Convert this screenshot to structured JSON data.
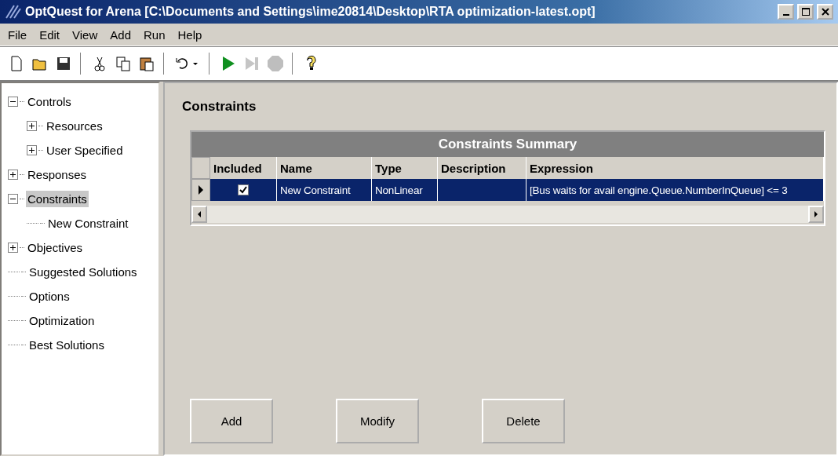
{
  "window": {
    "title": "OptQuest for Arena  [C:\\Documents and Settings\\ime20814\\Desktop\\RTA optimization-latest.opt]"
  },
  "menu": [
    "File",
    "Edit",
    "View",
    "Add",
    "Run",
    "Help"
  ],
  "toolbar": [
    {
      "kind": "new",
      "disabled": false
    },
    {
      "kind": "open",
      "disabled": false
    },
    {
      "kind": "save",
      "disabled": false
    },
    {
      "kind": "separator"
    },
    {
      "kind": "cut",
      "disabled": false
    },
    {
      "kind": "copy",
      "disabled": false
    },
    {
      "kind": "paste",
      "disabled": false
    },
    {
      "kind": "separator"
    },
    {
      "kind": "undo",
      "disabled": false
    },
    {
      "kind": "separator"
    },
    {
      "kind": "run",
      "disabled": false
    },
    {
      "kind": "step",
      "disabled": true
    },
    {
      "kind": "stop",
      "disabled": true
    },
    {
      "kind": "separator"
    },
    {
      "kind": "help",
      "disabled": false
    }
  ],
  "tree": [
    {
      "label": "Controls",
      "expanded": true,
      "selected": false,
      "children": [
        {
          "label": "Resources",
          "expanded": false,
          "selected": false
        },
        {
          "label": "User Specified",
          "expanded": false,
          "selected": false
        }
      ]
    },
    {
      "label": "Responses",
      "expanded": false,
      "selected": false
    },
    {
      "label": "Constraints",
      "expanded": true,
      "selected": true,
      "children": [
        {
          "label": "New Constraint",
          "selected": false
        }
      ]
    },
    {
      "label": "Objectives",
      "expanded": false,
      "selected": false
    },
    {
      "label": "Suggested Solutions",
      "selected": false
    },
    {
      "label": "Options",
      "selected": false
    },
    {
      "label": "Optimization",
      "selected": false
    },
    {
      "label": "Best Solutions",
      "selected": false
    }
  ],
  "panel": {
    "title": "Constraints"
  },
  "grid": {
    "title": "Constraints Summary",
    "columns": [
      "Included",
      "Name",
      "Type",
      "Description",
      "Expression"
    ],
    "rows": [
      {
        "selected": true,
        "included": true,
        "name": "New Constraint",
        "type": "NonLinear",
        "description": "",
        "expression": "[Bus waits for avail engine.Queue.NumberInQueue]  <= 3"
      }
    ]
  },
  "buttons": [
    "Add",
    "Modify",
    "Delete"
  ]
}
